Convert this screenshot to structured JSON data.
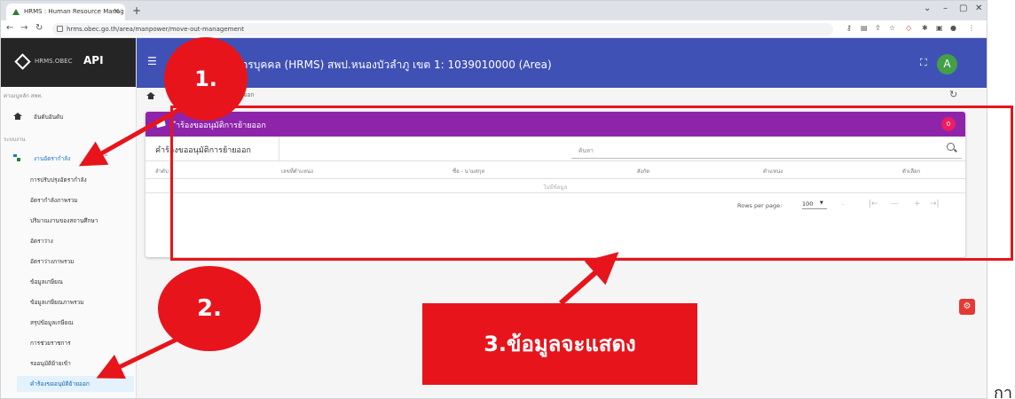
{
  "browser": {
    "tab_title": "HRMS : Human Resource Manag",
    "tab_close": "×",
    "new_tab": "+",
    "url": "hrms.obec.go.th/area/manpower/move-out-management"
  },
  "sidebar": {
    "brand_small": "HRMS.OBEC",
    "brand": "API",
    "section_main": "ค่าเมนูหลัก สพท.",
    "home": "อันดับอันดับ",
    "section_system": "ระบบงาน",
    "group": "งานอัตรากำลัง",
    "items": [
      "การปรับปรุงอัตรากำลัง",
      "อัตรากำลังภาพรวม",
      "ปริมาณงานของสถานศึกษา",
      "อัตราว่าง",
      "อัตราว่างภาพรวม",
      "ข้อมูลเกษียณ",
      "ข้อมูลเกษียณภาพรวม",
      "สรุปข้อมูลเกษียณ",
      "การช่วยราชการ",
      "รออนุมัติย้ายเข้า",
      "คำร้องขออนุมัติย้ายออก"
    ]
  },
  "appbar": {
    "title": "กรบุคคล (HRMS) สพป.หนองบัวลำภู เขต 1: 1039010000 (Area)",
    "avatar": "A",
    "fullscreen": "⛶"
  },
  "breadcrumb": {
    "text": "ขอนุมัติย้ายออก"
  },
  "card": {
    "title": "ำร้องขออนุมัติการย้ายออก",
    "badge": "0",
    "toolbar_label": "คำร้องขออนุมัติการย้ายออก",
    "search_placeholder": "ค้นหา",
    "columns": [
      "ลำดับ",
      "เลขที่ตำแหน่ง",
      "ชื่อ - นามสกุล",
      "สังกัด",
      "ตำแหน่ง",
      "ตัวเลือก"
    ],
    "empty": "ไม่มีข้อมูล",
    "rows_per_page_label": "Rows per page:",
    "rows_per_page": "100",
    "range": "-"
  },
  "annotations": {
    "step1": "1.",
    "step2": "2.",
    "step3": "3.ข้อมูลจะแสดง",
    "corner_text": "กา"
  },
  "colors": {
    "appbar": "#3f51b5",
    "card_header": "#8e24aa",
    "annotation_red": "#e8141b"
  }
}
